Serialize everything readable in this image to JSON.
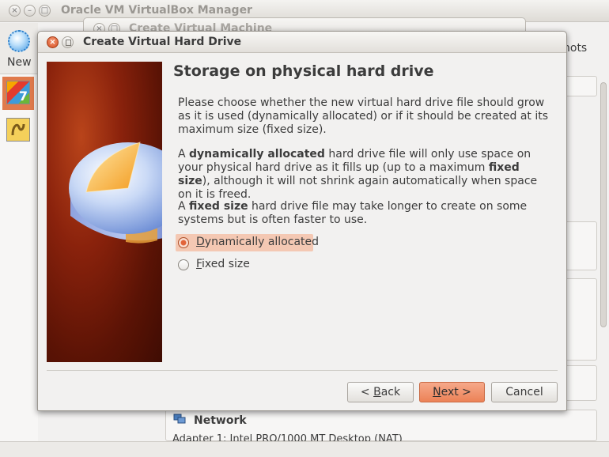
{
  "main_window": {
    "title": "Oracle VM VirtualBox Manager",
    "toolbar": {
      "new_label": "New"
    },
    "partial_tab_label": "hots",
    "network_heading": "Network",
    "adapter_text": "Adapter 1:  Intel PRO/1000 MT Desktop (NAT)"
  },
  "background_dialog": {
    "title": "Create Virtual Machine"
  },
  "dialog": {
    "title": "Create Virtual Hard Drive",
    "heading": "Storage on physical hard drive",
    "para1": "Please choose whether the new virtual hard drive file should grow as it is used (dynamically allocated) or if it should be created at its maximum size (fixed size).",
    "para2": {
      "t1": "A ",
      "b1": "dynamically allocated",
      "t2": " hard drive file will only use space on your physical hard drive as it fills up (up to a maximum ",
      "b2": "fixed size",
      "t3": "), although it will not shrink again automatically when space on it is freed."
    },
    "para3": {
      "t1": "A ",
      "b1": "fixed size",
      "t2": " hard drive file may take longer to create on some systems but is often faster to use."
    },
    "options": [
      {
        "mnemonic": "D",
        "rest": "ynamically allocated",
        "selected": true
      },
      {
        "mnemonic": "F",
        "rest": "ixed size",
        "selected": false
      }
    ],
    "buttons": {
      "back": {
        "prefix": "< ",
        "mnemonic": "B",
        "rest": "ack"
      },
      "next": {
        "mnemonic": "N",
        "rest": "ext >"
      },
      "cancel": "Cancel"
    }
  },
  "colors": {
    "accent": "#ec8257",
    "selection": "#f4c8b3",
    "image_background": "#8a220c",
    "close_button": "#d64f22"
  },
  "icons": [
    "close-icon",
    "minimize-icon",
    "maximize-icon",
    "new-vm-icon",
    "windows-vm-icon",
    "linux-vm-icon",
    "network-icon",
    "hard-disk-illustration"
  ]
}
